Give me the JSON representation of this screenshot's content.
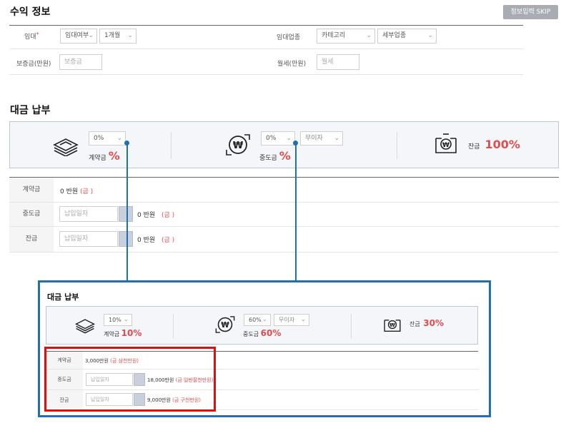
{
  "income": {
    "title": "수익 정보",
    "skip_button": "정보입력 SKIP",
    "rent_label": "임대",
    "rent_status": "임대여부",
    "rent_period": "1개월",
    "business_label": "임대업종",
    "category": "카테고리",
    "sub_category": "세부업종",
    "deposit_label": "보증금(만원)",
    "deposit_placeholder": "보증금",
    "monthly_label": "월세(만원)",
    "monthly_placeholder": "월세"
  },
  "payment": {
    "title": "대금 납부",
    "contract_pct_select": "0%",
    "contract_label": "계약금",
    "middle_pct_select": "0%",
    "interest_select": "무이자",
    "middle_label": "중도금",
    "balance_label": "잔금",
    "balance_pct": "100%",
    "pct_sign": "%",
    "rows": [
      {
        "label": "계약금",
        "amount": "0 반원",
        "note": "(금 )"
      },
      {
        "label": "중도금",
        "date_placeholder": "납입일자",
        "amount": "0 반원",
        "note": "(금 )"
      },
      {
        "label": "잔금",
        "date_placeholder": "납입일자",
        "amount": "0 반원",
        "note": "(금 )"
      }
    ]
  },
  "example": {
    "title": "대금 납부",
    "contract_pct_select": "10%",
    "contract_label": "계약금",
    "contract_pct": "10%",
    "middle_pct_select": "60%",
    "interest_select": "무이자",
    "middle_label": "중도금",
    "middle_pct": "60%",
    "balance_label": "잔금",
    "balance_pct": "30%",
    "rows": [
      {
        "label": "계약금",
        "amount": "3,000만원",
        "note": "(금 삼천만원)"
      },
      {
        "label": "중도금",
        "date_placeholder": "납입일자",
        "amount": "18,000만원",
        "note": "(금 일반팔천만원)"
      },
      {
        "label": "잔금",
        "date_placeholder": "납입일자",
        "amount": "9,000만원",
        "note": "(금 구천만원)"
      }
    ]
  },
  "colors": {
    "callout_blue": "#1f6fb2",
    "highlight_red": "#e10e0e",
    "percent_red": "#e24c4c"
  }
}
